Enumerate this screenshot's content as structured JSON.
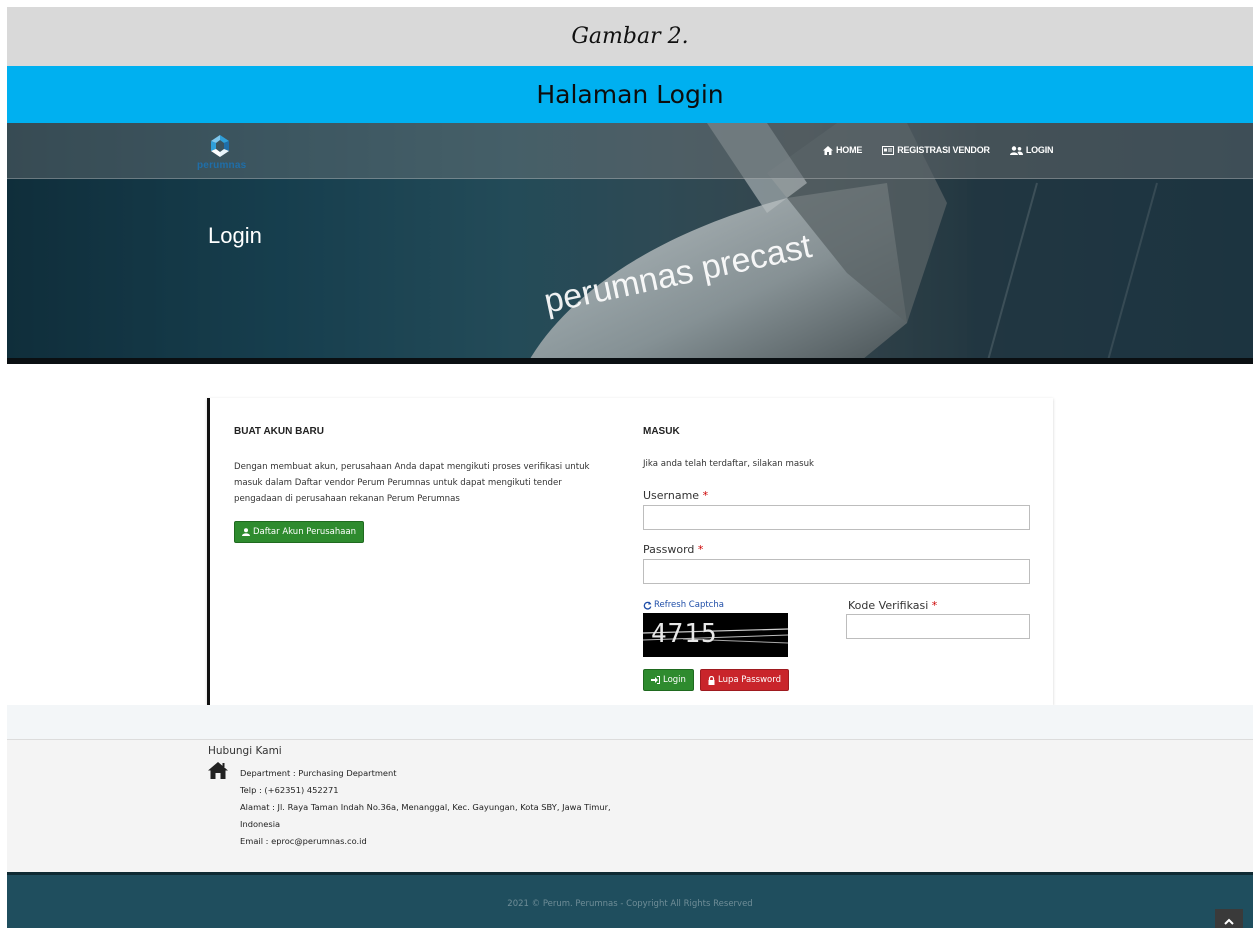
{
  "document": {
    "caption": "Gambar 2.",
    "title": "Halaman Login"
  },
  "header": {
    "logo_text": "perumnas",
    "hero_title": "Login",
    "hero_image_text": "perumnas precast",
    "nav": [
      {
        "label": "HOME",
        "icon": "home-icon"
      },
      {
        "label": "REGISTRASI VENDOR",
        "icon": "id-card-icon"
      },
      {
        "label": "LOGIN",
        "icon": "users-icon"
      }
    ]
  },
  "register": {
    "title": "BUAT AKUN BARU",
    "description": "Dengan membuat akun, perusahaan Anda dapat mengikuti proses verifikasi untuk masuk dalam Daftar vendor Perum Perumnas untuk dapat mengikuti tender pengadaan di perusahaan rekanan Perum Perumnas",
    "button_label": "Daftar Akun Perusahaan"
  },
  "login": {
    "title": "MASUK",
    "description": "Jika anda telah terdaftar, silakan masuk",
    "username_label": "Username",
    "username_value": "",
    "password_label": "Password",
    "password_value": "",
    "required_marker": "*",
    "refresh_captcha": "Refresh Captcha",
    "captcha_code": "4715",
    "verification_label": "Kode Verifikasi",
    "verification_value": "",
    "login_button": "Login",
    "forgot_button": "Lupa Password"
  },
  "footer": {
    "title": "Hubungi Kami",
    "department": "Department : Purchasing Department",
    "phone": "Telp : (+62351) 452271",
    "address": "Alamat : Jl. Raya Taman Indah No.36a, Menanggal, Kec. Gayungan, Kota SBY, Jawa Timur, Indonesia",
    "email": "Email : eproc@perumnas.co.id",
    "copyright": "2021 © Perum. Perumnas - Copyright All Rights Reserved"
  },
  "colors": {
    "title_bar": "#00b0f0",
    "green_button": "#2e8b2e",
    "red_button": "#c9252b",
    "footer_bar": "#1f4e5e"
  }
}
